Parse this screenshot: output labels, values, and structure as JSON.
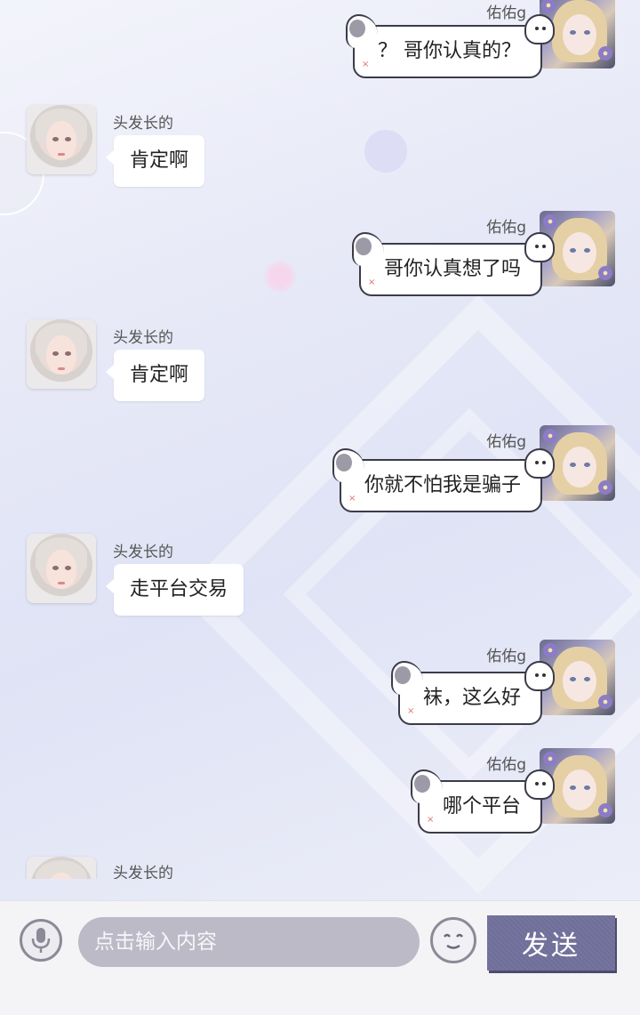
{
  "colors": {
    "input_bg": "#bcbac6",
    "send_bg": "#7675a0",
    "bubble_border": "#3b3b4a"
  },
  "messages": [
    {
      "side": "right",
      "name": "佑佑g",
      "text": "？ 哥你认真的？"
    },
    {
      "side": "left",
      "name": "头发长的",
      "text": "肯定啊"
    },
    {
      "side": "right",
      "name": "佑佑g",
      "text": "哥你认真想了吗"
    },
    {
      "side": "left",
      "name": "头发长的",
      "text": "肯定啊"
    },
    {
      "side": "right",
      "name": "佑佑g",
      "text": "你就不怕我是骗子"
    },
    {
      "side": "left",
      "name": "头发长的",
      "text": "走平台交易"
    },
    {
      "side": "right",
      "name": "佑佑g",
      "text": "袜，这么好"
    },
    {
      "side": "right",
      "name": "佑佑g",
      "text": "哪个平台"
    },
    {
      "side": "left",
      "name": "头发长的",
      "text": ""
    }
  ],
  "input_bar": {
    "mic_icon": "microphone-icon",
    "placeholder": "点击输入内容",
    "emoji_icon": "smiley-face-icon",
    "send_label": "发送"
  }
}
